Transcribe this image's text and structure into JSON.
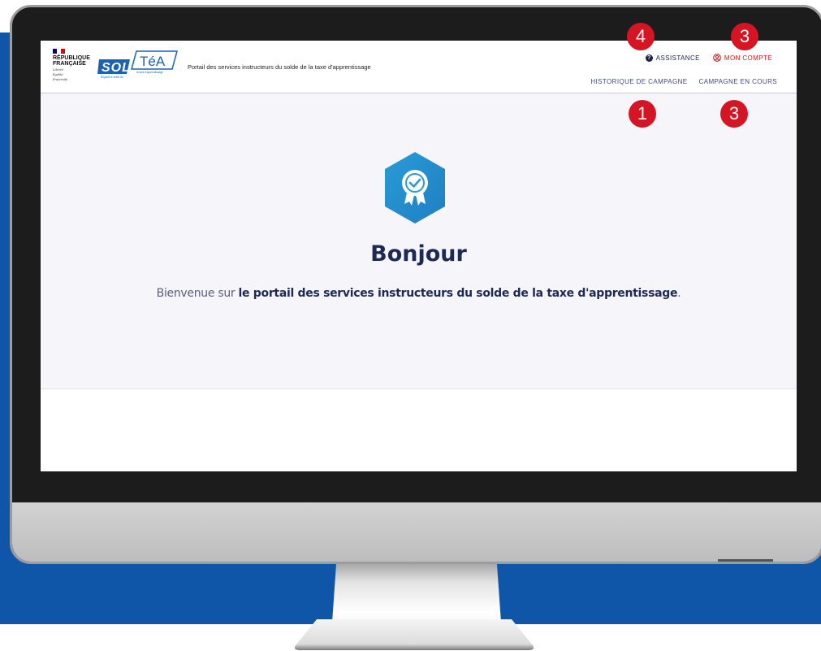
{
  "page": {
    "background_color": "#0f56a9",
    "monitor_color": "#1c1c1c"
  },
  "header": {
    "republique": [
      "RÉPUBLIQUE",
      "FRANÇAISE"
    ],
    "motto": [
      "Liberté",
      "Égalité",
      "Fraternité"
    ],
    "logo_sol": "SOL",
    "logo_tea": "TéA",
    "logo_tagline": "Répartir le solde de",
    "logo_tagline_2": "la taxe d'apprentissage",
    "portal_title": "Portail des services instructeurs du solde de la taxe d'apprentissage",
    "nav_top": {
      "assistance": "ASSISTANCE",
      "account": "MON COMPTE"
    },
    "nav_bottom": {
      "history": "HISTORIQUE DE CAMPAGNE",
      "current": "CAMPAGNE EN COURS"
    },
    "icons": {
      "assistance": "question-circle-icon",
      "account": "user-circle-icon"
    }
  },
  "main": {
    "badge_icon": "award-badge-icon",
    "greeting": "Bonjour",
    "welcome_plain": "Bienvenue sur ",
    "welcome_strong": "le portail des services instructeurs du solde de la taxe d'apprentissage",
    "welcome_end": "."
  },
  "annotations": {
    "assistance_marker": "4",
    "account_marker": "3",
    "history_marker": "1",
    "current_marker": "3",
    "color": "#d51424"
  }
}
